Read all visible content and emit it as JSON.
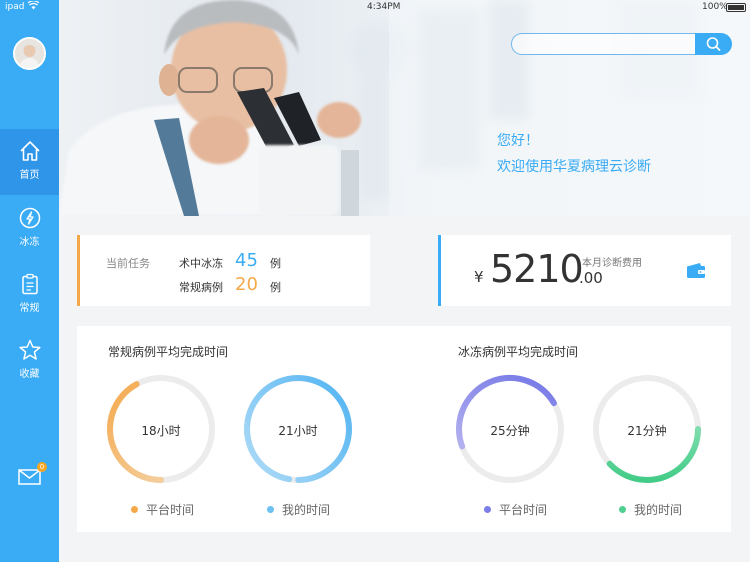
{
  "status_bar": {
    "carrier": "ipad",
    "time": "4:34PM",
    "battery": "100%"
  },
  "sidebar": {
    "items": [
      {
        "label": "首页",
        "icon": "home-icon",
        "active": true
      },
      {
        "label": "冰冻",
        "icon": "lightning-icon",
        "active": false
      },
      {
        "label": "常规",
        "icon": "clipboard-icon",
        "active": false
      },
      {
        "label": "收藏",
        "icon": "star-icon",
        "active": false
      }
    ],
    "mail_badge": "0"
  },
  "hero": {
    "search": {
      "placeholder": "",
      "value": ""
    },
    "greeting_line1": "您好！",
    "greeting_line2": "欢迎使用华夏病理云诊断"
  },
  "task_card": {
    "title": "当前任务",
    "rows": [
      {
        "label": "术中冰冻",
        "count": "45",
        "unit": "例"
      },
      {
        "label": "常规病例",
        "count": "20",
        "unit": "例"
      }
    ]
  },
  "fee_card": {
    "currency": "¥",
    "amount_int": "5210",
    "amount_dec": ".00",
    "label": "本月诊断费用"
  },
  "stats": {
    "regular": {
      "title": "常规病例平均完成时间",
      "platform": {
        "text": "18小时",
        "fraction": 0.42
      },
      "mine": {
        "text": "21小时",
        "fraction": 0.97
      },
      "legend_platform": "平台时间",
      "legend_mine": "我的时间"
    },
    "frozen": {
      "title": "冰冻病例平均完成时间",
      "platform": {
        "text": "25分钟",
        "fraction": 0.47
      },
      "mine": {
        "text": "21分钟",
        "fraction": 0.38
      },
      "legend_platform": "平台时间",
      "legend_mine": "我的时间"
    }
  },
  "colors": {
    "primary": "#3aabf5",
    "orange": "#f5a84a",
    "light_blue": "#6cc0f2",
    "purple": "#7b7ee8",
    "green": "#4fd08f"
  }
}
